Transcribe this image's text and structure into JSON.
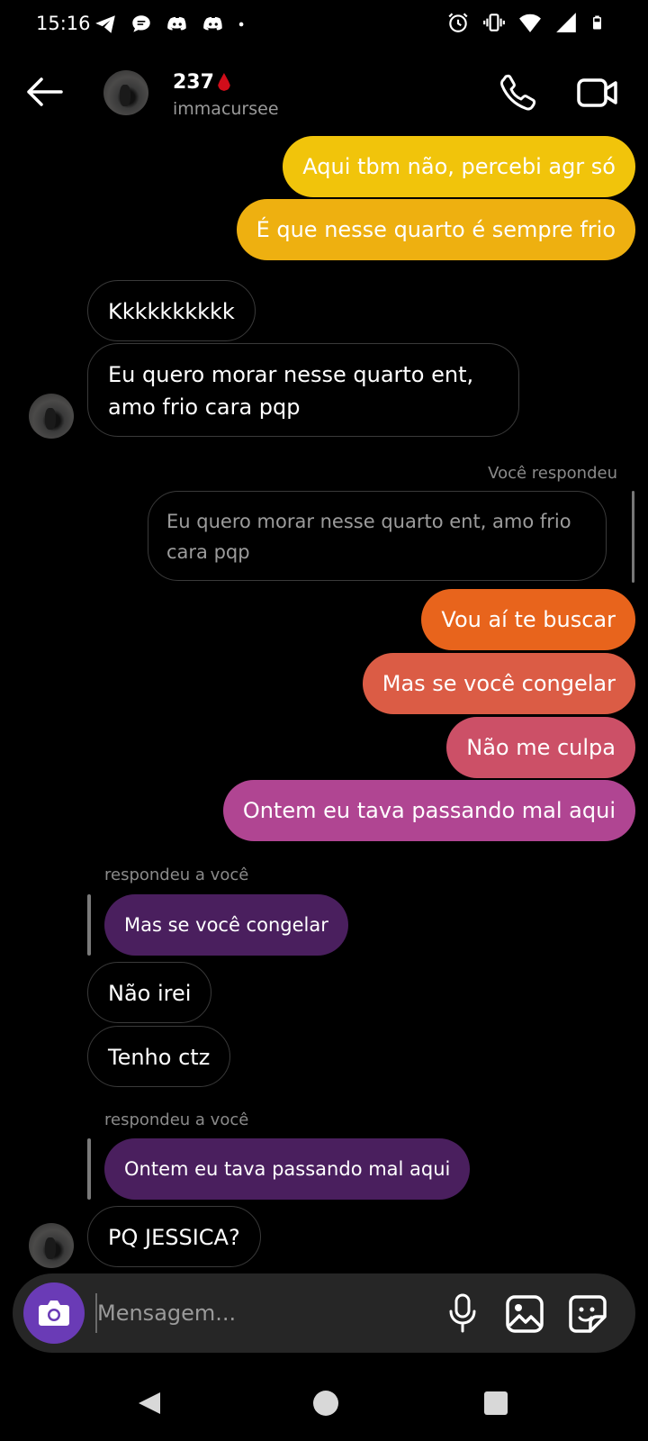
{
  "status_bar": {
    "time": "15:16",
    "left_icons": [
      "telegram-icon",
      "chat-bubble-icon",
      "discord-icon",
      "discord-icon",
      "dot-icon"
    ],
    "right_icons": [
      "alarm-icon",
      "vibrate-icon",
      "wifi-icon",
      "signal-icon",
      "battery-icon"
    ]
  },
  "header": {
    "name": "237",
    "name_emoji": "drop-of-blood",
    "username": "immacursee",
    "icons": {
      "back": "arrow-left-icon",
      "call": "phone-icon",
      "video": "video-camera-icon"
    }
  },
  "messages": {
    "out_1": "Aqui tbm não, percebi agr só",
    "out_2": "É que nesse quarto é sempre frio",
    "in_1": "Kkkkkkkkkk",
    "in_2_line1": "Eu quero morar nesse quarto ent,",
    "in_2_line2": "amo frio cara pqp",
    "reply_label_out": "Você respondeu",
    "reply_quote_out_line1": "Eu quero morar nesse quarto ent, amo frio",
    "reply_quote_out_line2": "cara pqp",
    "out_3": "Vou aí te buscar",
    "out_4": "Mas se você congelar",
    "out_5": "Não me culpa",
    "out_6": "Ontem eu tava passando mal aqui",
    "reply_label_in_1": "respondeu a você",
    "quote_in_1": "Mas se você congelar",
    "in_3": "Não irei",
    "in_4": "Tenho ctz",
    "reply_label_in_2": "respondeu a você",
    "quote_in_2": "Ontem eu tava passando mal aqui",
    "in_5": "PQ JESSICA?"
  },
  "bubble_colors": {
    "out_1": "#f1c40b",
    "out_2": "#eeb010",
    "out_3": "#e8641c",
    "out_4": "#db5c45",
    "out_5": "#cc5067",
    "out_6": "#b04592",
    "quote_in": "#4a1f5e"
  },
  "composer": {
    "placeholder": "Mensagem...",
    "icons": [
      "camera-icon",
      "microphone-icon",
      "gallery-icon",
      "sticker-icon"
    ]
  },
  "navbar": {
    "icons": [
      "nav-back-icon",
      "nav-home-icon",
      "nav-recents-icon"
    ]
  }
}
